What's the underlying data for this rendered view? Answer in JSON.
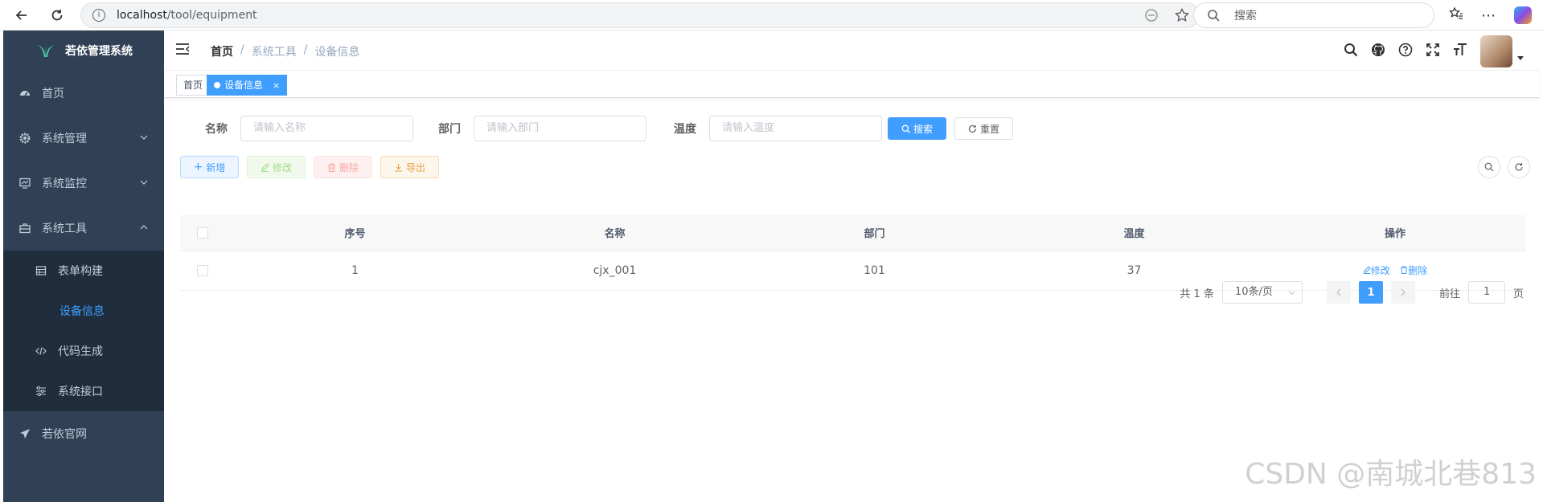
{
  "browser": {
    "url_host": "localhost",
    "url_path": "/tool/equipment",
    "search_placeholder": "搜索"
  },
  "sidebar": {
    "logo_text": "若依管理系统",
    "items": [
      {
        "label": "首页",
        "icon": "dashboard-icon"
      },
      {
        "label": "系统管理",
        "icon": "gear-icon"
      },
      {
        "label": "系统监控",
        "icon": "monitor-icon"
      },
      {
        "label": "系统工具",
        "icon": "toolbox-icon"
      }
    ],
    "subitems": [
      {
        "label": "表单构建",
        "icon": "form-icon"
      },
      {
        "label": "设备信息",
        "active": true
      },
      {
        "label": "代码生成",
        "icon": "code-icon"
      },
      {
        "label": "系统接口",
        "icon": "sliders-icon"
      }
    ],
    "footer_item": {
      "label": "若依官网",
      "icon": "send-icon"
    }
  },
  "breadcrumb": [
    "首页",
    "系统工具",
    "设备信息"
  ],
  "tags": [
    {
      "label": "首页"
    },
    {
      "label": "设备信息",
      "close": "×",
      "active": true
    }
  ],
  "filter": {
    "name_label": "名称",
    "name_placeholder": "请输入名称",
    "dept_label": "部门",
    "dept_placeholder": "请输入部门",
    "temp_label": "温度",
    "temp_placeholder": "请输入温度",
    "search_button": "搜索",
    "reset_button": "重置"
  },
  "toolbar": {
    "add": "新增",
    "edit": "修改",
    "delete": "删除",
    "export": "导出"
  },
  "table": {
    "headers": [
      "序号",
      "名称",
      "部门",
      "温度",
      "操作"
    ],
    "rows": [
      {
        "index": "1",
        "name": "cjx_001",
        "dept": "101",
        "temp": "37",
        "edit": "修改",
        "delete": "删除"
      }
    ]
  },
  "pagination": {
    "total": "共 1 条",
    "page_size": "10条/页",
    "current": "1",
    "goto_label": "前往",
    "goto_value": "1",
    "page_suffix": "页"
  },
  "watermark": "CSDN @南城北巷813",
  "colors": {
    "primary": "#409eff",
    "sidebar": "#304156",
    "submenu": "#1f2d3d"
  }
}
